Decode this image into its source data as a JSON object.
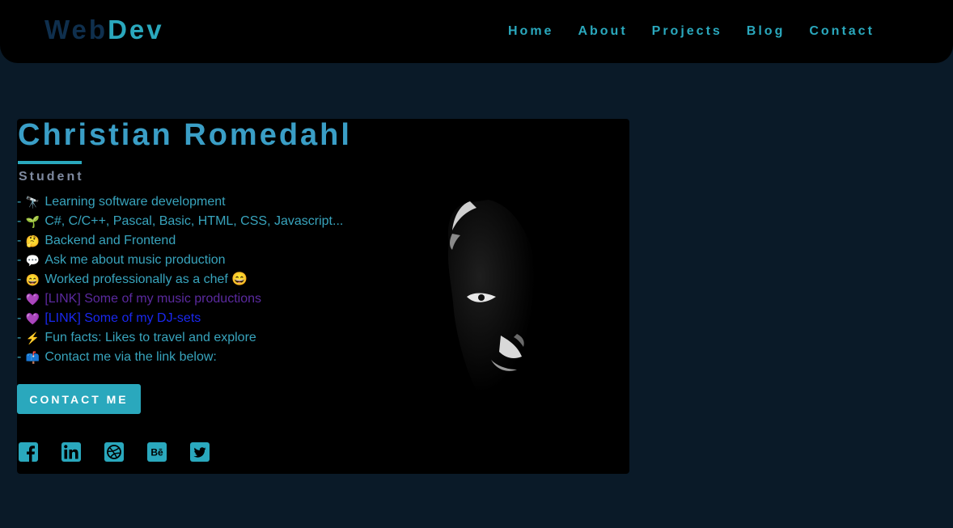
{
  "header": {
    "logo_part1": "Web",
    "logo_part2": "Dev",
    "nav": [
      "Home",
      "About",
      "Projects",
      "Blog",
      "Contact"
    ]
  },
  "profile": {
    "name": "Christian Romedahl",
    "role": "Student",
    "facts": [
      {
        "emoji": "🔭",
        "text": "Learning software development"
      },
      {
        "emoji": "🌱",
        "text": "C#, C/C++, Pascal, Basic, HTML, CSS, Javascript..."
      },
      {
        "emoji": "🤔",
        "text": "Backend and Frontend"
      },
      {
        "emoji": "💬",
        "text": "Ask me about music production"
      },
      {
        "emoji": "😄",
        "text": "Worked professionally as a chef 😄"
      },
      {
        "emoji": "💜",
        "text": "[LINK] Some of my music productions"
      },
      {
        "emoji": "💜",
        "text": "[LINK] Some of my DJ-sets"
      },
      {
        "emoji": "⚡",
        "text": "Fun facts: Likes to travel and explore"
      },
      {
        "emoji": "📫",
        "text": "Contact me via the link below:"
      }
    ],
    "dash": "-",
    "contact_button": "CONTACT ME"
  },
  "socials": [
    "facebook-icon",
    "linkedin-icon",
    "dribbble-icon",
    "behance-icon",
    "twitter-icon"
  ],
  "colors": {
    "background": "#0a1a28",
    "accent": "#2aa8bd",
    "logo_dark": "#0f2f4d",
    "visited_link": "#5b2aa0",
    "link": "#1a28f0"
  }
}
